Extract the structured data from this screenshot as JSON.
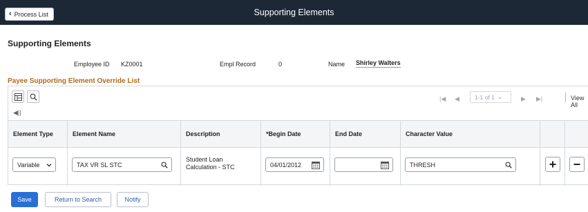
{
  "header": {
    "back_label": "Process List",
    "title": "Supporting Elements"
  },
  "page": {
    "title": "Supporting Elements",
    "employee_id_label": "Employee ID",
    "employee_id": "KZ0001",
    "empl_record_label": "Empl Record",
    "empl_record": "0",
    "name_label": "Name",
    "name": "Shirley Walters"
  },
  "grid": {
    "title": "Payee Supporting Element Override List",
    "pager": "1-1 of 1",
    "view_all": "View All",
    "columns": [
      "Element Type",
      "Element Name",
      "Description",
      "*Begin Date",
      "End Date",
      "Character Value"
    ],
    "rows": [
      {
        "element_type": "Variable",
        "element_name": "TAX VR SL STC",
        "description_line1": "Student Loan",
        "description_line2": "Calculation - STC",
        "begin_date": "04/01/2012",
        "end_date": "",
        "character_value": "THRESH"
      }
    ]
  },
  "footer": {
    "save": "Save",
    "return_to_search": "Return to Search",
    "notify": "Notify"
  },
  "colors": {
    "topbar": "#1c2836",
    "grid_title": "#b06a1e",
    "primary": "#2a6fd6"
  }
}
